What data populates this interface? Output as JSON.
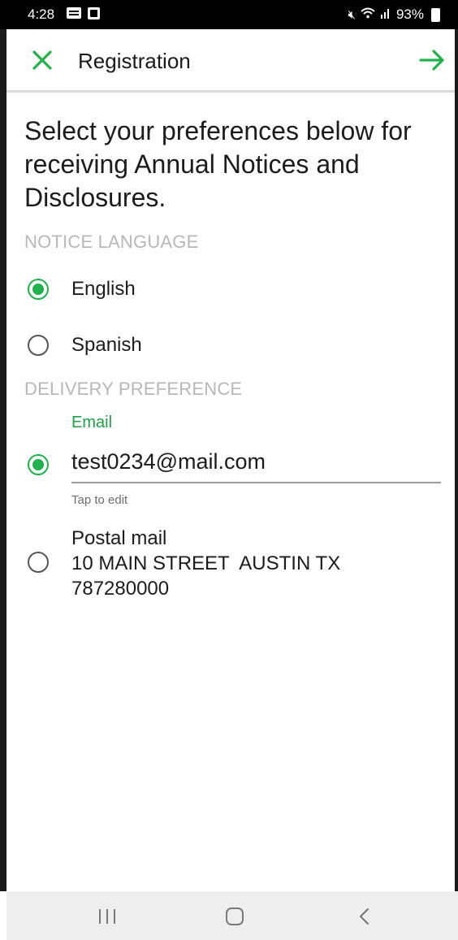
{
  "status_bar": {
    "time": "4:28",
    "battery": "93%",
    "icons": [
      "message-icon",
      "photo-icon",
      "mute-icon",
      "wifi-icon",
      "signal-icon",
      "battery-icon"
    ]
  },
  "app_bar": {
    "title": "Registration",
    "close_icon": "close-icon",
    "next_icon": "arrow-right-icon"
  },
  "main": {
    "heading": "Select your preferences below for receiving Annual Notices and Disclosures.",
    "notice_language": {
      "label": "NOTICE LANGUAGE",
      "options": [
        {
          "label": "English",
          "selected": true
        },
        {
          "label": "Spanish",
          "selected": false
        }
      ]
    },
    "delivery_preference": {
      "label": "DELIVERY PREFERENCE",
      "email": {
        "caption": "Email",
        "value": "test0234@mail.com",
        "hint": "Tap to edit",
        "selected": true
      },
      "postal": {
        "title": "Postal mail",
        "address_line1": "10 MAIN STREET  AUSTIN TX",
        "address_line2": "787280000",
        "selected": false
      }
    }
  },
  "colors": {
    "accent": "#22b24c",
    "section_label": "#b8b8b8",
    "nav_bar": "#eeeeee"
  },
  "nav_bar": {
    "icons": [
      "recent-apps-icon",
      "home-icon",
      "back-icon"
    ]
  }
}
